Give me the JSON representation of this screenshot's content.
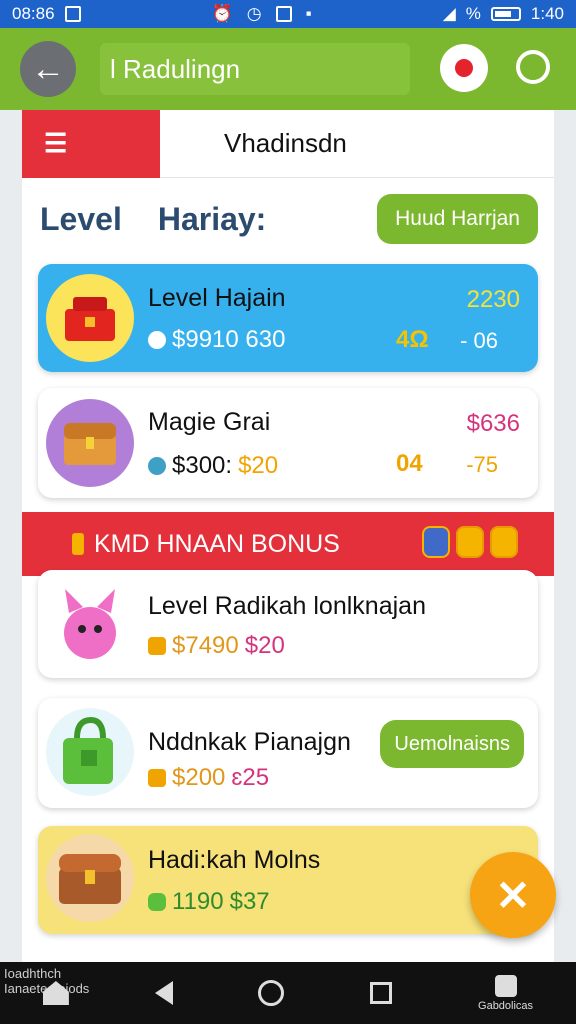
{
  "status_bar": {
    "time": "08:86",
    "right_text": "%",
    "clock": "1:40"
  },
  "app_bar": {
    "title": "l Radulingn"
  },
  "section": {
    "title": "Vhadinsdn"
  },
  "level_row": {
    "label": "Level",
    "sublabel": "Hariay:",
    "button": "Huud Harrjan"
  },
  "cards": [
    {
      "title": "Level Hajain",
      "price": "$9910 630",
      "right_top": "2230",
      "mid": "4Ω",
      "right_bot": "- 06",
      "bg": "#37b1ee",
      "title_color": "#111",
      "right_top_color": "#f4e23a",
      "mid_color": "#f5c400",
      "right_bot_color": "#fff",
      "price_color": "#fff",
      "icon": "toolbox-icon"
    },
    {
      "title": "Magie Grai",
      "price": "$300:",
      "price2": "$20",
      "right_top": "$636",
      "mid": "04",
      "right_bot": "-75",
      "bg": "#ffffff",
      "right_top_color": "#d6337d",
      "mid_color": "#f0a400",
      "right_bot_color": "#f0a400",
      "icon": "treasure-chest-icon"
    }
  ],
  "bonus": {
    "label": "KMD HNAAN BONUS"
  },
  "bonus_cards": [
    {
      "title": "Level Radikah lonlknajan",
      "price": "$7490",
      "price2": "$20",
      "icon": "pink-creature-icon"
    },
    {
      "title": "Nddnkak Pianajgn",
      "price": "$200",
      "price2": "ɛ25",
      "button": "Uemolnaisns",
      "icon": "green-bag-icon"
    },
    {
      "title": "Hadi:kah Molns",
      "price": "1190",
      "price2": "$37",
      "icon": "chest-icon"
    }
  ],
  "nav_bar": {
    "left_label": "Ioadhthch Ianaeteoteiods",
    "right_label": "Gabdolicas"
  },
  "colors": {
    "primary_green": "#7cb82f",
    "accent_red": "#e4303b",
    "fab_orange": "#f7a414",
    "status_blue": "#1e63c9"
  }
}
